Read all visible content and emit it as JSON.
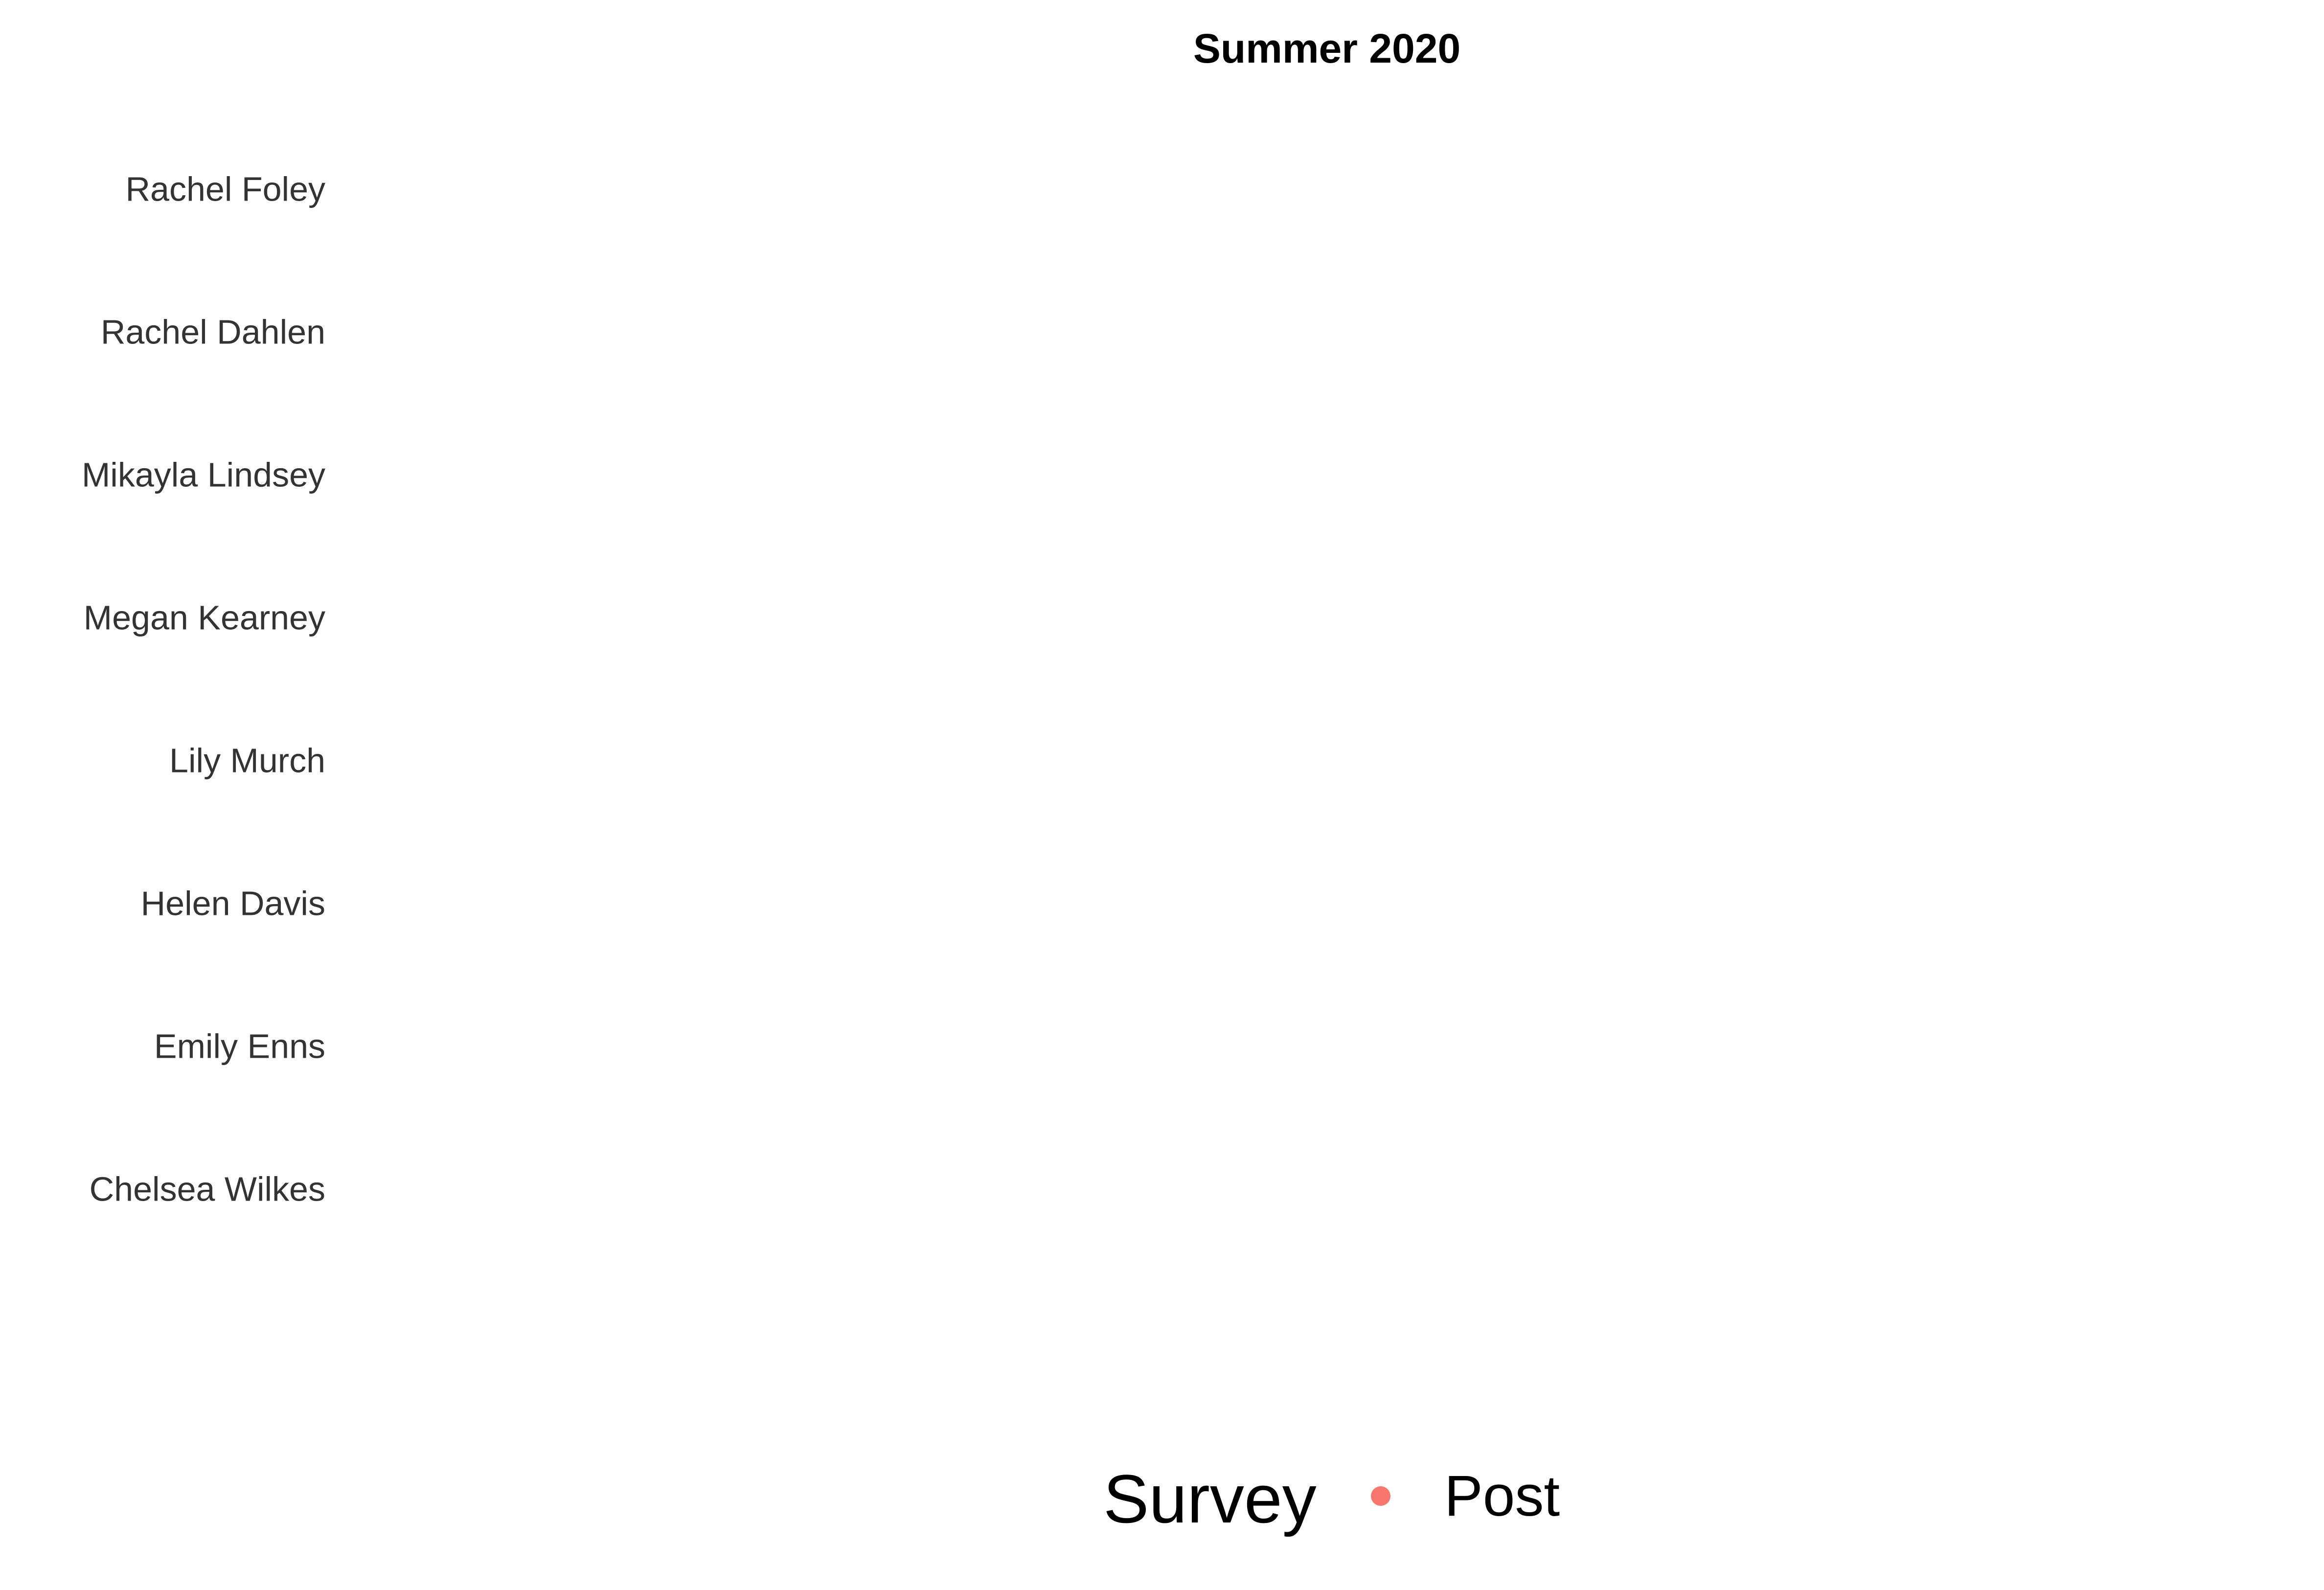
{
  "chart_data": {
    "type": "scatter",
    "title": "Summer 2020",
    "xlabel": "",
    "ylabel": "",
    "categories": [
      "Rachel Foley",
      "Rachel Dahlen",
      "Mikayla Lindsey",
      "Megan Kearney",
      "Lily Murch",
      "Helen Davis",
      "Emily Enns",
      "Chelsea Wilkes"
    ],
    "series": [
      {
        "name": "Post",
        "color": "#F8766D",
        "values": []
      }
    ],
    "grid": false,
    "legend": {
      "title": "Survey",
      "position": "bottom",
      "items": [
        {
          "label": "Post",
          "color": "#F8766D",
          "marker": "circle"
        }
      ]
    }
  }
}
